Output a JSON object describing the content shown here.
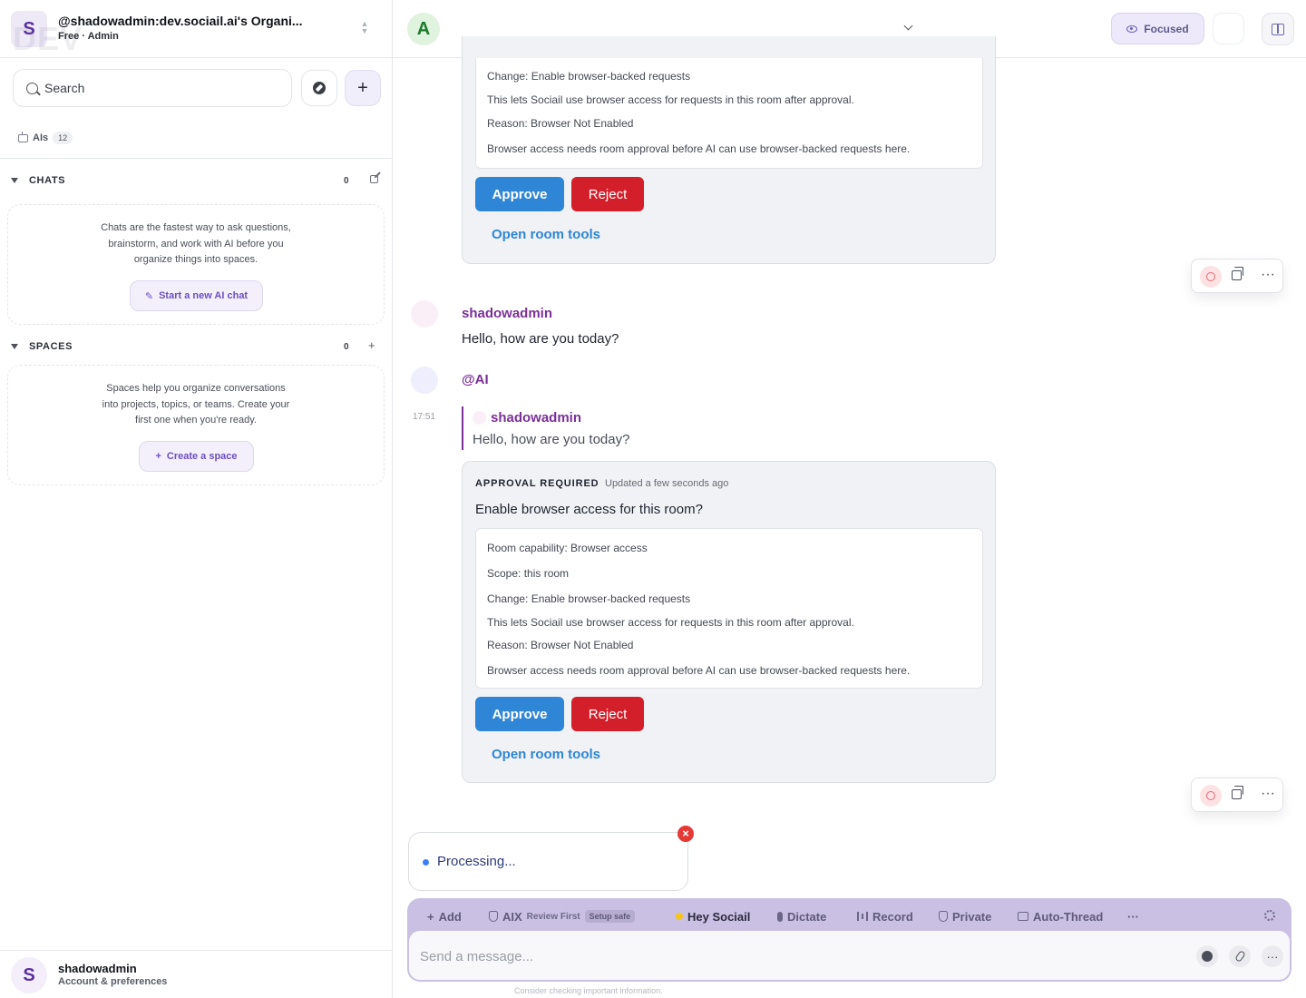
{
  "sidebar": {
    "org_initial": "S",
    "watermark": "DEV",
    "org_name": "@shadowadmin:dev.sociail.ai's Organi...",
    "org_plan": "Free · Admin",
    "search_placeholder": "Search",
    "ais_label": "AIs",
    "ais_count": "12",
    "chats": {
      "title": "CHATS",
      "count": "0",
      "empty_text": "Chats are the fastest way to ask questions, brainstorm, and work with AI before you organize things into spaces.",
      "button": "Start a new AI chat"
    },
    "spaces": {
      "title": "SPACES",
      "count": "0",
      "empty_text": "Spaces help you organize conversations into projects, topics, or teams. Create your first one when you're ready.",
      "button": "Create a space"
    },
    "account": {
      "initial": "S",
      "name": "shadowadmin",
      "sub": "Account & preferences"
    }
  },
  "header": {
    "room_initial": "A",
    "focused_label": "Focused"
  },
  "messages": {
    "approval_top": {
      "lines": [
        "Change: Enable browser-backed requests",
        "This lets Sociail use browser access for requests in this room after approval.",
        "Reason: Browser Not Enabled",
        "Browser access needs room approval before AI can use browser-backed requests here."
      ],
      "approve": "Approve",
      "reject": "Reject",
      "tools": "Open room tools"
    },
    "user_msg": {
      "author": "shadowadmin",
      "text": "Hello, how are you today?"
    },
    "ai_msg": {
      "author": "@AI",
      "time": "17:51",
      "quote_author": "shadowadmin",
      "quote_text": "Hello, how are you today?"
    },
    "approval_main": {
      "heading": "APPROVAL REQUIRED",
      "updated": "Updated a few seconds ago",
      "question": "Enable browser access for this room?",
      "lines": [
        "Room capability: Browser access",
        "Scope: this room",
        "Change: Enable browser-backed requests",
        "This lets Sociail use browser access for requests in this room after approval.",
        "Reason: Browser Not Enabled",
        "Browser access needs room approval before AI can use browser-backed requests here."
      ],
      "approve": "Approve",
      "reject": "Reject",
      "tools": "Open room tools"
    }
  },
  "processing": {
    "text": "Processing...",
    "dismiss": "×"
  },
  "composer": {
    "add": "Add",
    "aix": "AIX",
    "aix_mode": "Review First",
    "aix_pill": "Setup safe",
    "hey": "Hey Sociail",
    "dictate": "Dictate",
    "record": "Record",
    "private": "Private",
    "auto_thread": "Auto-Thread",
    "more": "···",
    "placeholder": "Send a message...",
    "disclaimer": "Consider checking important information."
  }
}
